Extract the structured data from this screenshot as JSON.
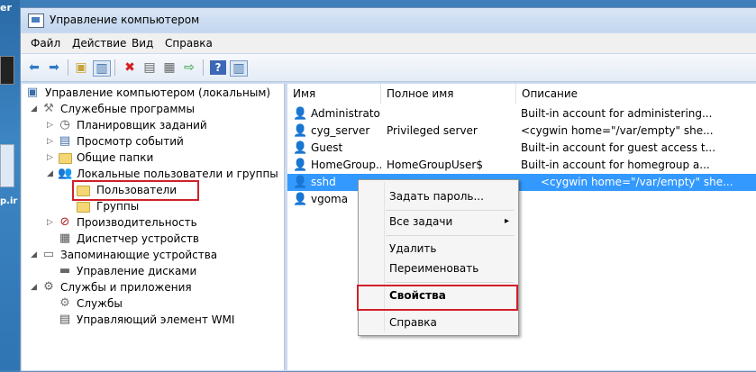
{
  "desktop": {
    "label_top": "er",
    "label_mid": "p.ir"
  },
  "window": {
    "title": "Управление компьютером"
  },
  "menu": [
    "Файл",
    "Действие",
    "Вид",
    "Справка"
  ],
  "toolbar_icons": [
    "back-arrow-icon",
    "forward-arrow-icon",
    "up-folder-icon",
    "show-hide-tree-icon",
    "delete-icon",
    "properties-icon",
    "export-icon",
    "help-icon",
    "action-pane-icon"
  ],
  "tree": {
    "root": "Управление компьютером (локальным)",
    "system_tools": "Служебные программы",
    "task_scheduler": "Планировщик заданий",
    "event_viewer": "Просмотр событий",
    "shared_folders": "Общие папки",
    "local_users": "Локальные пользователи и группы",
    "users": "Пользователи",
    "groups": "Группы",
    "performance": "Производительность",
    "device_manager": "Диспетчер устройств",
    "storage": "Запоминающие устройства",
    "disk_management": "Управление дисками",
    "services_apps": "Службы и приложения",
    "services": "Службы",
    "wmi": "Управляющий элемент WMI"
  },
  "list": {
    "columns": [
      "Имя",
      "Полное имя",
      "Описание"
    ],
    "rows": [
      {
        "name": "Administrator",
        "full": "",
        "desc": "Built-in account for administering..."
      },
      {
        "name": "cyg_server",
        "full": "Privileged server",
        "desc": "<cygwin home=\"/var/empty\" she..."
      },
      {
        "name": "Guest",
        "full": "",
        "desc": "Built-in account for guest access t..."
      },
      {
        "name": "HomeGroup...",
        "full": "HomeGroupUser$",
        "desc": "Built-in account for homegroup a..."
      },
      {
        "name": "sshd",
        "full": "",
        "desc": "<cygwin home=\"/var/empty\" she..."
      },
      {
        "name": "vgoma",
        "full": "",
        "desc": ""
      }
    ]
  },
  "context_menu": {
    "set_password": "Задать пароль...",
    "all_tasks": "Все задачи",
    "all_tasks_arrow": "▸",
    "delete": "Удалить",
    "rename": "Переименовать",
    "properties": "Свойства",
    "help": "Справка"
  },
  "colors": {
    "highlight_box": "#d0202a",
    "selection": "#3399ff"
  }
}
